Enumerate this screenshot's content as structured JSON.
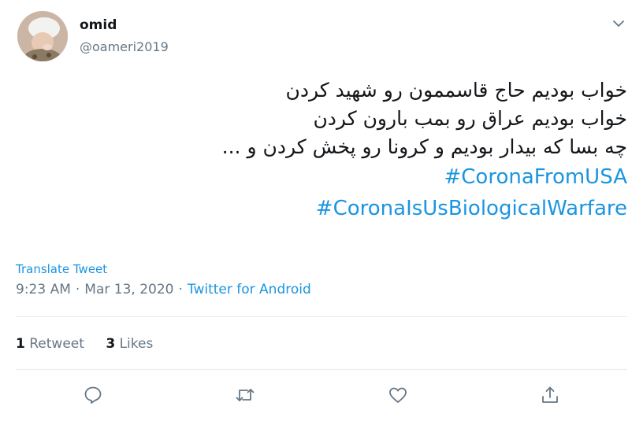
{
  "author": {
    "name": "omid",
    "handle": "@oameri2019"
  },
  "tweet": {
    "lines": [
      "خواب بودیم حاج قاسممون رو شهید کردن",
      "خواب بودیم عراق رو بمب بارون کردن",
      "چه بسا که بیدار بودیم و کرونا رو پخش کردن و ..."
    ],
    "hashtags": [
      "#CoronaFromUSA",
      "#CoronaIsUsBiologicalWarfare"
    ],
    "translate_label": "Translate Tweet",
    "time": "9:23 AM",
    "date": "Mar 13, 2020",
    "separator": "·",
    "source": "Twitter for Android"
  },
  "stats": {
    "retweets_count": "1",
    "retweets_label": "Retweet",
    "likes_count": "3",
    "likes_label": "Likes"
  },
  "icons": {
    "menu": "chevron-down-icon",
    "reply": "reply-icon",
    "retweet": "retweet-icon",
    "like": "heart-icon",
    "share": "share-icon"
  },
  "colors": {
    "link": "#1b95e0",
    "secondary_text": "#657786",
    "primary_text": "#14171a",
    "divider": "#e6ecf0"
  }
}
